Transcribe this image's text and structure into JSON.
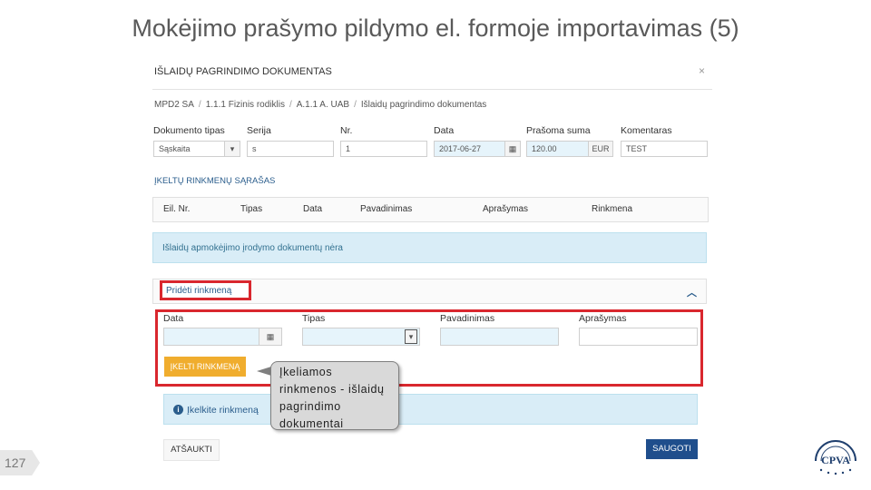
{
  "slide": {
    "title": "Mokėjimo prašymo pildymo el. formoje importavimas (5)",
    "page_number": "127"
  },
  "dialog": {
    "title": "IŠLAIDŲ PAGRINDIMO DOKUMENTAS",
    "close_symbol": "×",
    "breadcrumb": [
      "MPD2 SA",
      "1.1.1 Fizinis rodiklis",
      "A.1.1 A. UAB",
      "Išlaidų pagrindimo dokumentas"
    ],
    "fields": {
      "doc_type_label": "Dokumento tipas",
      "doc_type_value": "Sąskaita",
      "series_label": "Serija",
      "series_value": "s",
      "number_label": "Nr.",
      "number_value": "1",
      "date_label": "Data",
      "date_value": "2017-06-27",
      "amount_label": "Prašoma suma",
      "amount_value": "120.00",
      "currency": "EUR",
      "comment_label": "Komentaras",
      "comment_value": "TEST"
    },
    "files_section_title": "ĮKELTŲ RINKMENŲ SĄRAŠAS",
    "table_columns": [
      "Eil. Nr.",
      "Tipas",
      "Data",
      "Pavadinimas",
      "Aprašymas",
      "Rinkmena"
    ],
    "empty_info": "Išlaidų apmokėjimo įrodymo dokumentų nėra",
    "add_file_label": "Pridėti rinkmeną",
    "upload_fields": {
      "date_label": "Data",
      "type_label": "Tipas",
      "name_label": "Pavadinimas",
      "desc_label": "Aprašymas"
    },
    "upload_button": "ĮKELTI RINKMENĄ",
    "upload_info": "Įkelkite rinkmeną",
    "cancel_button": "ATŠAUKTI",
    "save_button": "SAUGOTI"
  },
  "callout": {
    "text": "Įkeliamos rinkmenos - išlaidų pagrindimo dokumentai"
  },
  "logo": {
    "text": "CPVA"
  },
  "icons": {
    "close": "close-icon",
    "calendar": "calendar-icon",
    "dropdown": "chevron-down-icon",
    "collapse": "chevron-up-icon",
    "info": "info-icon"
  },
  "colors": {
    "highlight_red": "#d9272e",
    "upload_orange": "#f0ad2e",
    "save_blue": "#1f4e8c",
    "info_bg": "#d9edf7"
  }
}
